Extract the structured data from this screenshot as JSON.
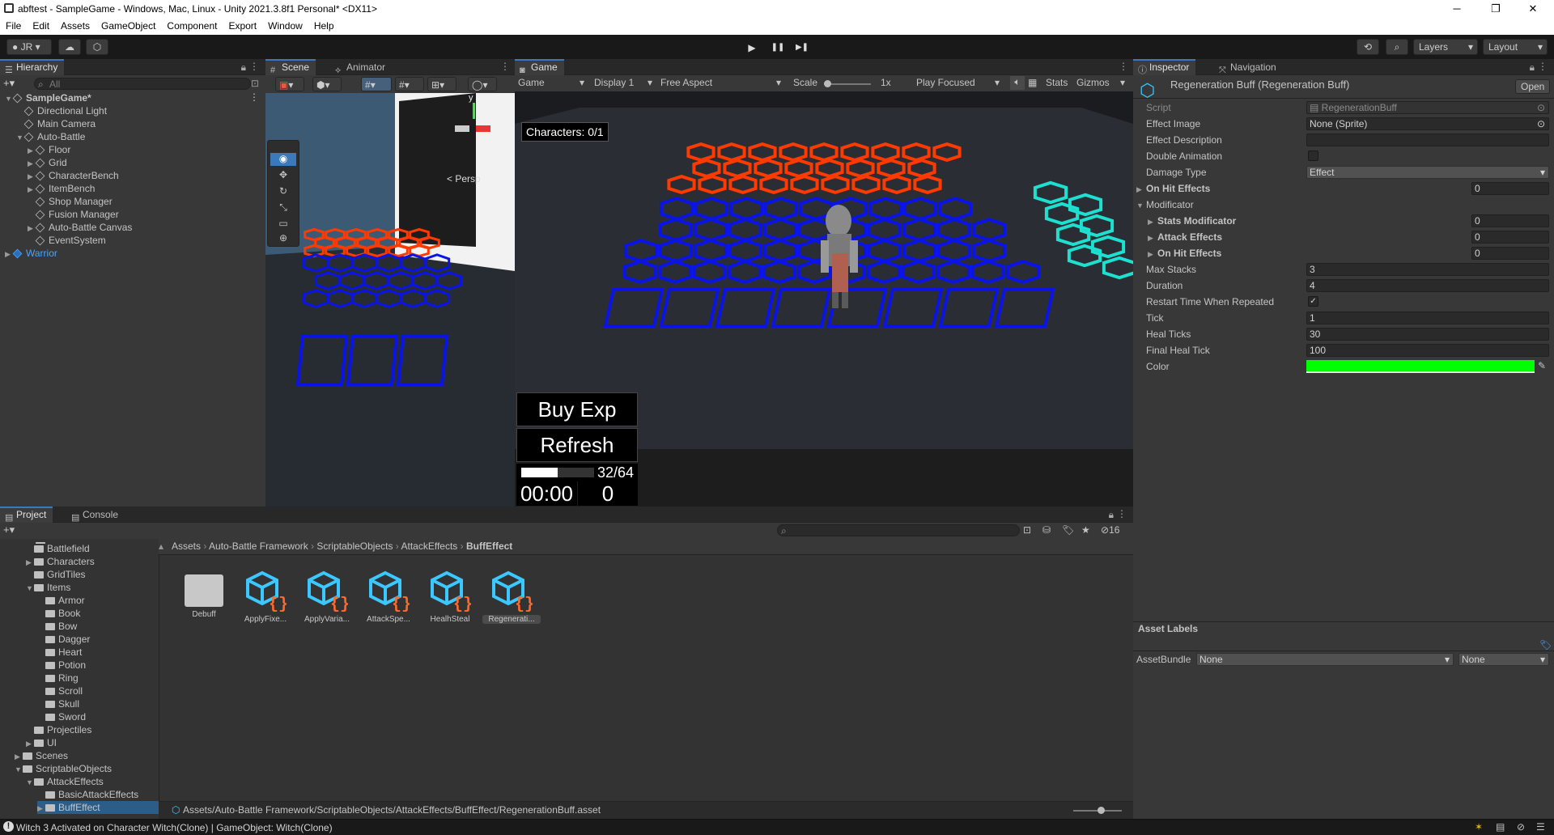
{
  "window": {
    "title": "abftest - SampleGame - Windows, Mac, Linux - Unity 2021.3.8f1 Personal* <DX11>",
    "minimize": "─",
    "maximize": "❐",
    "close": "✕"
  },
  "menu": [
    "File",
    "Edit",
    "Assets",
    "GameObject",
    "Component",
    "Export",
    "Window",
    "Help"
  ],
  "toolbar": {
    "account": "JR",
    "layers": "Layers",
    "layout": "Layout",
    "play": "▶",
    "pause": "❚❚",
    "step": "▶❚"
  },
  "hierarchy": {
    "tab": "Hierarchy",
    "search_placeholder": "All",
    "items": [
      {
        "label": "SampleGame*",
        "indent": 0,
        "arrow": "▼",
        "bold": true
      },
      {
        "label": "Directional Light",
        "indent": 1,
        "arrow": ""
      },
      {
        "label": "Main Camera",
        "indent": 1,
        "arrow": ""
      },
      {
        "label": "Auto-Battle",
        "indent": 1,
        "arrow": "▼"
      },
      {
        "label": "Floor",
        "indent": 2,
        "arrow": "▶"
      },
      {
        "label": "Grid",
        "indent": 2,
        "arrow": "▶"
      },
      {
        "label": "CharacterBench",
        "indent": 2,
        "arrow": "▶"
      },
      {
        "label": "ItemBench",
        "indent": 2,
        "arrow": "▶"
      },
      {
        "label": "Shop Manager",
        "indent": 2,
        "arrow": ""
      },
      {
        "label": "Fusion Manager",
        "indent": 2,
        "arrow": ""
      },
      {
        "label": "Auto-Battle Canvas",
        "indent": 2,
        "arrow": "▶"
      },
      {
        "label": "EventSystem",
        "indent": 2,
        "arrow": ""
      },
      {
        "label": "Warrior",
        "indent": 0,
        "arrow": "▶",
        "blue": true
      }
    ]
  },
  "scene": {
    "tabs": [
      "Scene",
      "Animator"
    ],
    "persp": "< Persp"
  },
  "game": {
    "tab": "Game",
    "toolbar": {
      "mode": "Game",
      "display": "Display 1",
      "aspect": "Free Aspect",
      "scale_label": "Scale",
      "scale_value": "1x",
      "play_focused": "Play Focused",
      "stats": "Stats",
      "gizmos": "Gizmos"
    },
    "characters": "Characters: 0/1",
    "buy_exp": "Buy Exp",
    "refresh": "Refresh",
    "exp": "32/64",
    "exp_fraction": 0.5,
    "timer": "00:00",
    "gold": "0"
  },
  "inspector": {
    "tabs": [
      "Inspector",
      "Navigation"
    ],
    "title": "Regeneration Buff (Regeneration Buff)",
    "open_button": "Open",
    "fields": [
      {
        "label": "Script",
        "value": "RegenerationBuff",
        "type": "script"
      },
      {
        "label": "Effect Image",
        "value": "None (Sprite)",
        "type": "object"
      },
      {
        "label": "Effect Description",
        "value": "",
        "type": "text"
      },
      {
        "label": "Double Animation",
        "value": "",
        "type": "check-off"
      },
      {
        "label": "Damage Type",
        "value": "Effect",
        "type": "dropdown"
      },
      {
        "label": "On Hit Effects",
        "value": "0",
        "type": "list",
        "bold": true,
        "arrow": "▶"
      },
      {
        "label": "Modificator",
        "value": "",
        "type": "group",
        "arrow": "▼"
      },
      {
        "label": "Stats Modificator",
        "value": "0",
        "type": "list",
        "bold": true,
        "arrow": "▶",
        "indent": true
      },
      {
        "label": "Attack Effects",
        "value": "0",
        "type": "list",
        "bold": true,
        "arrow": "▶",
        "indent": true
      },
      {
        "label": "On Hit Effects",
        "value": "0",
        "type": "list",
        "bold": true,
        "arrow": "▶",
        "indent": true
      },
      {
        "label": "Max Stacks",
        "value": "3",
        "type": "text"
      },
      {
        "label": "Duration",
        "value": "4",
        "type": "text"
      },
      {
        "label": "Restart Time When Repeated",
        "value": "✓",
        "type": "check-on"
      },
      {
        "label": "Tick",
        "value": "1",
        "type": "text"
      },
      {
        "label": "Heal Ticks",
        "value": "30",
        "type": "text"
      },
      {
        "label": "Final Heal Tick",
        "value": "100",
        "type": "text"
      },
      {
        "label": "Color",
        "value": "",
        "type": "color"
      }
    ],
    "color_value": "#00ff00",
    "asset_labels": "Asset Labels",
    "asset_bundle_label": "AssetBundle",
    "asset_bundle_value": "None",
    "asset_bundle_variant": "None"
  },
  "project": {
    "tabs": [
      "Project",
      "Console"
    ],
    "hidden_count": "16",
    "breadcrumb": [
      "Assets",
      "Auto-Battle Framework",
      "ScriptableObjects",
      "AttackEffects",
      "BuffEffect"
    ],
    "tree": [
      {
        "label": "Battlefield",
        "indent": 2,
        "arrow": ""
      },
      {
        "label": "Characters",
        "indent": 2,
        "arrow": "▶"
      },
      {
        "label": "GridTiles",
        "indent": 2,
        "arrow": ""
      },
      {
        "label": "Items",
        "indent": 2,
        "arrow": "▼"
      },
      {
        "label": "Armor",
        "indent": 3,
        "arrow": ""
      },
      {
        "label": "Book",
        "indent": 3,
        "arrow": ""
      },
      {
        "label": "Bow",
        "indent": 3,
        "arrow": ""
      },
      {
        "label": "Dagger",
        "indent": 3,
        "arrow": ""
      },
      {
        "label": "Heart",
        "indent": 3,
        "arrow": ""
      },
      {
        "label": "Potion",
        "indent": 3,
        "arrow": ""
      },
      {
        "label": "Ring",
        "indent": 3,
        "arrow": ""
      },
      {
        "label": "Scroll",
        "indent": 3,
        "arrow": ""
      },
      {
        "label": "Skull",
        "indent": 3,
        "arrow": ""
      },
      {
        "label": "Sword",
        "indent": 3,
        "arrow": ""
      },
      {
        "label": "Projectiles",
        "indent": 2,
        "arrow": ""
      },
      {
        "label": "UI",
        "indent": 2,
        "arrow": "▶"
      },
      {
        "label": "Scenes",
        "indent": 1,
        "arrow": "▶"
      },
      {
        "label": "ScriptableObjects",
        "indent": 1,
        "arrow": "▼"
      },
      {
        "label": "AttackEffects",
        "indent": 2,
        "arrow": "▼"
      },
      {
        "label": "BasicAttackEffects",
        "indent": 3,
        "arrow": ""
      },
      {
        "label": "BuffEffect",
        "indent": 3,
        "arrow": "▶",
        "selected": true
      }
    ],
    "assets": [
      {
        "label": "Debuff",
        "kind": "folder"
      },
      {
        "label": "ApplyFixe...",
        "kind": "script"
      },
      {
        "label": "ApplyVaria...",
        "kind": "script"
      },
      {
        "label": "AttackSpe...",
        "kind": "script"
      },
      {
        "label": "HealhSteal",
        "kind": "script"
      },
      {
        "label": "Regenerati...",
        "kind": "script",
        "selected": true
      }
    ],
    "path": "Assets/Auto-Battle Framework/ScriptableObjects/AttackEffects/BuffEffect/RegenerationBuff.asset"
  },
  "status": "Witch 3 Activated on Character Witch(Clone) | GameObject: Witch(Clone)",
  "colors": {
    "red_hex": "#ff3a00",
    "blue_hex": "#0a14e6",
    "cyan_hex": "#1ee0d0",
    "accent": "#3a79bb"
  }
}
